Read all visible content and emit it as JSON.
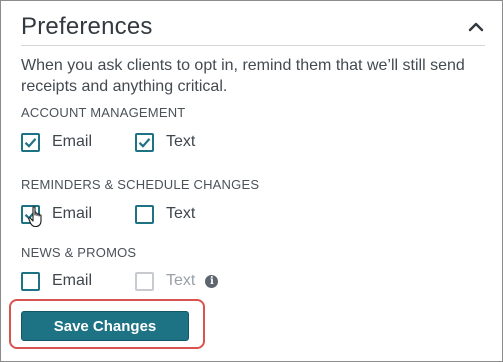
{
  "panel": {
    "title": "Preferences",
    "collapse_icon": "chevron-up-icon",
    "description": "When you ask clients to opt in, remind them that we’ll still send receipts and anything critical."
  },
  "sections": [
    {
      "label": "ACCOUNT MANAGEMENT",
      "options": [
        {
          "label": "Email",
          "checked": true,
          "disabled": false
        },
        {
          "label": "Text",
          "checked": true,
          "disabled": false
        }
      ]
    },
    {
      "label": "REMINDERS & SCHEDULE CHANGES",
      "options": [
        {
          "label": "Email",
          "checked": true,
          "disabled": false
        },
        {
          "label": "Text",
          "checked": false,
          "disabled": false
        }
      ]
    },
    {
      "label": "NEWS & PROMOS",
      "options": [
        {
          "label": "Email",
          "checked": false,
          "disabled": false
        },
        {
          "label": "Text",
          "checked": false,
          "disabled": true
        }
      ]
    }
  ],
  "info_icon": {
    "glyph": "i",
    "icon": "info-icon"
  },
  "save_button": {
    "label": "Save Changes"
  },
  "colors": {
    "accent": "#1d7284",
    "highlight": "#d9534f",
    "disabled": "#c7cbcf"
  }
}
